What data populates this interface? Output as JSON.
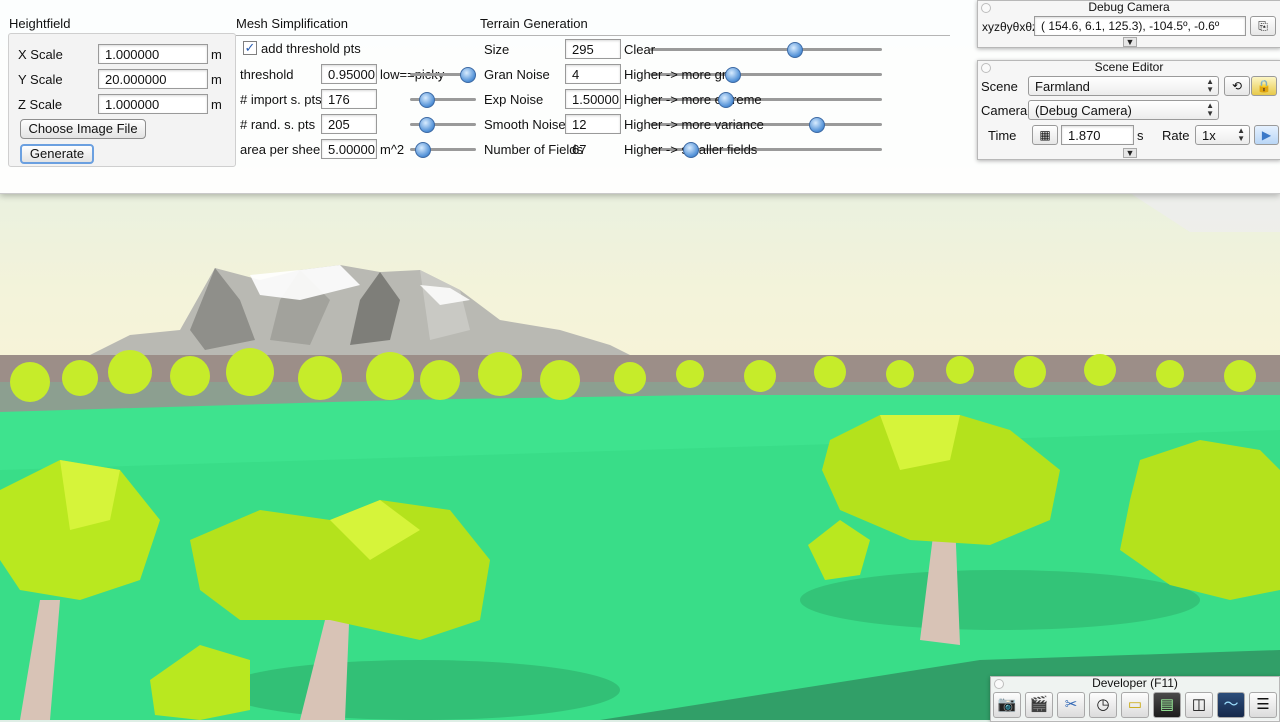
{
  "heightfield": {
    "title": "Heightfield",
    "rows": [
      {
        "label": "X Scale",
        "value": "1.000000",
        "unit": "m"
      },
      {
        "label": "Y Scale",
        "value": "20.000000",
        "unit": "m"
      },
      {
        "label": "Z Scale",
        "value": "1.000000",
        "unit": "m"
      }
    ],
    "choose_image_label": "Choose Image File",
    "generate_label": "Generate"
  },
  "mesh": {
    "title": "Mesh Simplification",
    "add_threshold_label": "add threshold pts",
    "add_threshold_checked": true,
    "rows": [
      {
        "label": "threshold",
        "value": "0.95000",
        "hint": "low==picky",
        "slider": 0.95
      },
      {
        "label": "# import s. pts",
        "value": "176",
        "hint": "",
        "slider": 0.25
      },
      {
        "label": "# rand. s. pts",
        "value": "205",
        "hint": "",
        "slider": 0.25
      },
      {
        "label": "area per sheep",
        "value": "5.00000",
        "hint": "m^2",
        "slider": 0.1
      }
    ]
  },
  "terrain": {
    "title": "Terrain Generation",
    "rows": [
      {
        "label": "Size",
        "value": "295",
        "hint": "Clear",
        "slider": 0.6
      },
      {
        "label": "Gran Noise",
        "value": "4",
        "hint": "Higher -> more gran",
        "slider": 0.35
      },
      {
        "label": "Exp Noise",
        "value": "1.50000",
        "hint": "Higher -> more extreme",
        "slider": 0.32
      },
      {
        "label": "Smooth Noise",
        "value": "12",
        "hint": "Higher -> more variance",
        "slider": 0.71
      },
      {
        "label": "Number of Fields",
        "value": "67",
        "hint": "Higher -> smaller fields",
        "slider": 0.17
      }
    ]
  },
  "debug_camera": {
    "title": "Debug Camera",
    "coord_label": "xyzθyθxθz",
    "coord_value": "( 154.6,   6.1,  125.3), -104.5º,  -0.6º"
  },
  "scene_editor": {
    "title": "Scene Editor",
    "scene_label": "Scene",
    "scene_value": "Farmland",
    "camera_label": "Camera",
    "camera_value": "(Debug Camera)",
    "time_label": "Time",
    "time_value": "1.870",
    "time_unit": "s",
    "rate_label": "Rate",
    "rate_value": "1x"
  },
  "developer": {
    "title": "Developer (F11)",
    "tools": [
      "camera-icon",
      "clapperboard-icon",
      "wrench-icon",
      "clock-icon",
      "note-icon",
      "terminal-icon",
      "windows-icon",
      "waveform-icon",
      "document-icon"
    ]
  }
}
